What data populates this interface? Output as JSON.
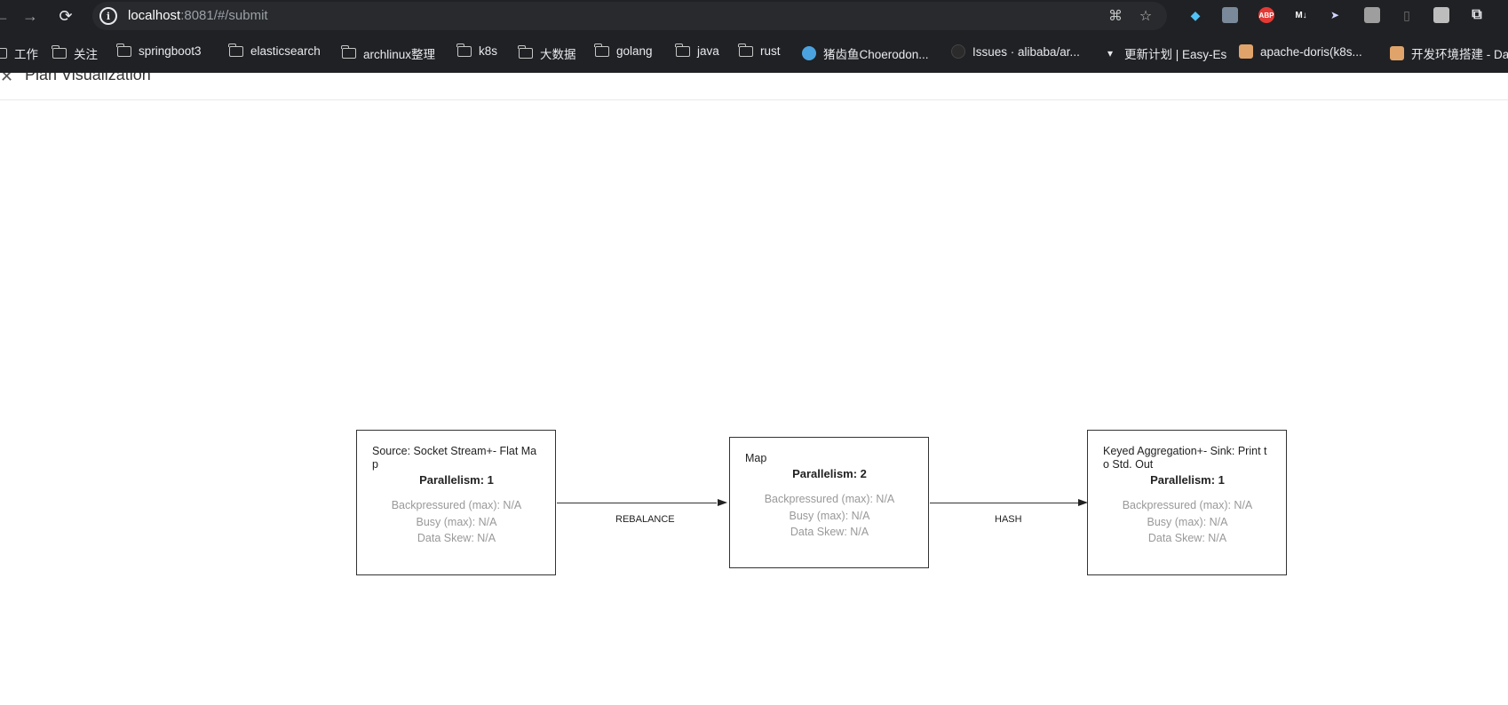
{
  "browser": {
    "url_host": "localhost",
    "url_path": ":8081/#/submit"
  },
  "bookmarks": [
    {
      "label": "工作",
      "icon": "folder-icon"
    },
    {
      "label": "关注",
      "icon": "folder-icon"
    },
    {
      "label": "springboot3",
      "icon": "folder-icon"
    },
    {
      "label": "elasticsearch",
      "icon": "folder-icon"
    },
    {
      "label": "archlinux整理",
      "icon": "folder-icon"
    },
    {
      "label": "k8s",
      "icon": "folder-icon"
    },
    {
      "label": "大数据",
      "icon": "folder-icon"
    },
    {
      "label": "golang",
      "icon": "folder-icon"
    },
    {
      "label": "java",
      "icon": "folder-icon"
    },
    {
      "label": "rust",
      "icon": "folder-icon"
    },
    {
      "label": "猪齿鱼Choerodon...",
      "icon": "fish-icon"
    },
    {
      "label": "Issues · alibaba/ar...",
      "icon": "github-icon"
    },
    {
      "label": "更新计划 | Easy-Es",
      "icon": "easy-es-icon"
    },
    {
      "label": "apache-doris(k8s...",
      "icon": "avatar-icon"
    },
    {
      "label": "开发环境搭建 - Da",
      "icon": "avatar-icon"
    }
  ],
  "page": {
    "title": "Plan Visualization"
  },
  "plan": {
    "nodes": [
      {
        "name": "Source: Socket Stream+- Flat Map",
        "parallelism": "Parallelism: 1",
        "backpressured": "Backpressured (max): N/A",
        "busy": "Busy (max): N/A",
        "skew": "Data Skew: N/A"
      },
      {
        "name": "Map",
        "parallelism": "Parallelism: 2",
        "backpressured": "Backpressured (max): N/A",
        "busy": "Busy (max): N/A",
        "skew": "Data Skew: N/A"
      },
      {
        "name": "Keyed Aggregation+- Sink: Print to Std. Out",
        "parallelism": "Parallelism: 1",
        "backpressured": "Backpressured (max): N/A",
        "busy": "Busy (max): N/A",
        "skew": "Data Skew: N/A"
      }
    ],
    "edges": [
      {
        "label": "REBALANCE"
      },
      {
        "label": "HASH"
      }
    ]
  }
}
